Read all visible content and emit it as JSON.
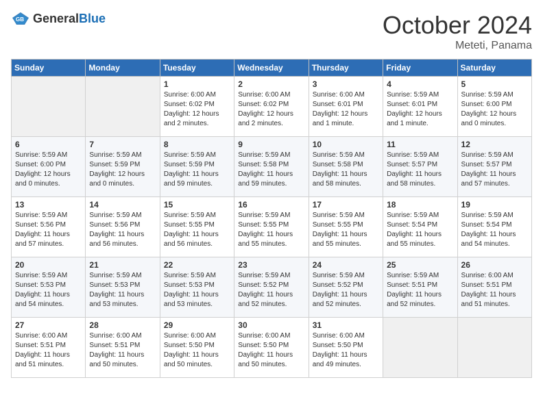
{
  "logo": {
    "text_general": "General",
    "text_blue": "Blue"
  },
  "header": {
    "month": "October 2024",
    "location": "Meteti, Panama"
  },
  "weekdays": [
    "Sunday",
    "Monday",
    "Tuesday",
    "Wednesday",
    "Thursday",
    "Friday",
    "Saturday"
  ],
  "weeks": [
    [
      {
        "day": "",
        "empty": true
      },
      {
        "day": "",
        "empty": true
      },
      {
        "day": "1",
        "sunrise": "Sunrise: 6:00 AM",
        "sunset": "Sunset: 6:02 PM",
        "daylight": "Daylight: 12 hours and 2 minutes."
      },
      {
        "day": "2",
        "sunrise": "Sunrise: 6:00 AM",
        "sunset": "Sunset: 6:02 PM",
        "daylight": "Daylight: 12 hours and 2 minutes."
      },
      {
        "day": "3",
        "sunrise": "Sunrise: 6:00 AM",
        "sunset": "Sunset: 6:01 PM",
        "daylight": "Daylight: 12 hours and 1 minute."
      },
      {
        "day": "4",
        "sunrise": "Sunrise: 5:59 AM",
        "sunset": "Sunset: 6:01 PM",
        "daylight": "Daylight: 12 hours and 1 minute."
      },
      {
        "day": "5",
        "sunrise": "Sunrise: 5:59 AM",
        "sunset": "Sunset: 6:00 PM",
        "daylight": "Daylight: 12 hours and 0 minutes."
      }
    ],
    [
      {
        "day": "6",
        "sunrise": "Sunrise: 5:59 AM",
        "sunset": "Sunset: 6:00 PM",
        "daylight": "Daylight: 12 hours and 0 minutes."
      },
      {
        "day": "7",
        "sunrise": "Sunrise: 5:59 AM",
        "sunset": "Sunset: 5:59 PM",
        "daylight": "Daylight: 12 hours and 0 minutes."
      },
      {
        "day": "8",
        "sunrise": "Sunrise: 5:59 AM",
        "sunset": "Sunset: 5:59 PM",
        "daylight": "Daylight: 11 hours and 59 minutes."
      },
      {
        "day": "9",
        "sunrise": "Sunrise: 5:59 AM",
        "sunset": "Sunset: 5:58 PM",
        "daylight": "Daylight: 11 hours and 59 minutes."
      },
      {
        "day": "10",
        "sunrise": "Sunrise: 5:59 AM",
        "sunset": "Sunset: 5:58 PM",
        "daylight": "Daylight: 11 hours and 58 minutes."
      },
      {
        "day": "11",
        "sunrise": "Sunrise: 5:59 AM",
        "sunset": "Sunset: 5:57 PM",
        "daylight": "Daylight: 11 hours and 58 minutes."
      },
      {
        "day": "12",
        "sunrise": "Sunrise: 5:59 AM",
        "sunset": "Sunset: 5:57 PM",
        "daylight": "Daylight: 11 hours and 57 minutes."
      }
    ],
    [
      {
        "day": "13",
        "sunrise": "Sunrise: 5:59 AM",
        "sunset": "Sunset: 5:56 PM",
        "daylight": "Daylight: 11 hours and 57 minutes."
      },
      {
        "day": "14",
        "sunrise": "Sunrise: 5:59 AM",
        "sunset": "Sunset: 5:56 PM",
        "daylight": "Daylight: 11 hours and 56 minutes."
      },
      {
        "day": "15",
        "sunrise": "Sunrise: 5:59 AM",
        "sunset": "Sunset: 5:55 PM",
        "daylight": "Daylight: 11 hours and 56 minutes."
      },
      {
        "day": "16",
        "sunrise": "Sunrise: 5:59 AM",
        "sunset": "Sunset: 5:55 PM",
        "daylight": "Daylight: 11 hours and 55 minutes."
      },
      {
        "day": "17",
        "sunrise": "Sunrise: 5:59 AM",
        "sunset": "Sunset: 5:55 PM",
        "daylight": "Daylight: 11 hours and 55 minutes."
      },
      {
        "day": "18",
        "sunrise": "Sunrise: 5:59 AM",
        "sunset": "Sunset: 5:54 PM",
        "daylight": "Daylight: 11 hours and 55 minutes."
      },
      {
        "day": "19",
        "sunrise": "Sunrise: 5:59 AM",
        "sunset": "Sunset: 5:54 PM",
        "daylight": "Daylight: 11 hours and 54 minutes."
      }
    ],
    [
      {
        "day": "20",
        "sunrise": "Sunrise: 5:59 AM",
        "sunset": "Sunset: 5:53 PM",
        "daylight": "Daylight: 11 hours and 54 minutes."
      },
      {
        "day": "21",
        "sunrise": "Sunrise: 5:59 AM",
        "sunset": "Sunset: 5:53 PM",
        "daylight": "Daylight: 11 hours and 53 minutes."
      },
      {
        "day": "22",
        "sunrise": "Sunrise: 5:59 AM",
        "sunset": "Sunset: 5:53 PM",
        "daylight": "Daylight: 11 hours and 53 minutes."
      },
      {
        "day": "23",
        "sunrise": "Sunrise: 5:59 AM",
        "sunset": "Sunset: 5:52 PM",
        "daylight": "Daylight: 11 hours and 52 minutes."
      },
      {
        "day": "24",
        "sunrise": "Sunrise: 5:59 AM",
        "sunset": "Sunset: 5:52 PM",
        "daylight": "Daylight: 11 hours and 52 minutes."
      },
      {
        "day": "25",
        "sunrise": "Sunrise: 5:59 AM",
        "sunset": "Sunset: 5:51 PM",
        "daylight": "Daylight: 11 hours and 52 minutes."
      },
      {
        "day": "26",
        "sunrise": "Sunrise: 6:00 AM",
        "sunset": "Sunset: 5:51 PM",
        "daylight": "Daylight: 11 hours and 51 minutes."
      }
    ],
    [
      {
        "day": "27",
        "sunrise": "Sunrise: 6:00 AM",
        "sunset": "Sunset: 5:51 PM",
        "daylight": "Daylight: 11 hours and 51 minutes."
      },
      {
        "day": "28",
        "sunrise": "Sunrise: 6:00 AM",
        "sunset": "Sunset: 5:51 PM",
        "daylight": "Daylight: 11 hours and 50 minutes."
      },
      {
        "day": "29",
        "sunrise": "Sunrise: 6:00 AM",
        "sunset": "Sunset: 5:50 PM",
        "daylight": "Daylight: 11 hours and 50 minutes."
      },
      {
        "day": "30",
        "sunrise": "Sunrise: 6:00 AM",
        "sunset": "Sunset: 5:50 PM",
        "daylight": "Daylight: 11 hours and 50 minutes."
      },
      {
        "day": "31",
        "sunrise": "Sunrise: 6:00 AM",
        "sunset": "Sunset: 5:50 PM",
        "daylight": "Daylight: 11 hours and 49 minutes."
      },
      {
        "day": "",
        "empty": true
      },
      {
        "day": "",
        "empty": true
      }
    ]
  ]
}
